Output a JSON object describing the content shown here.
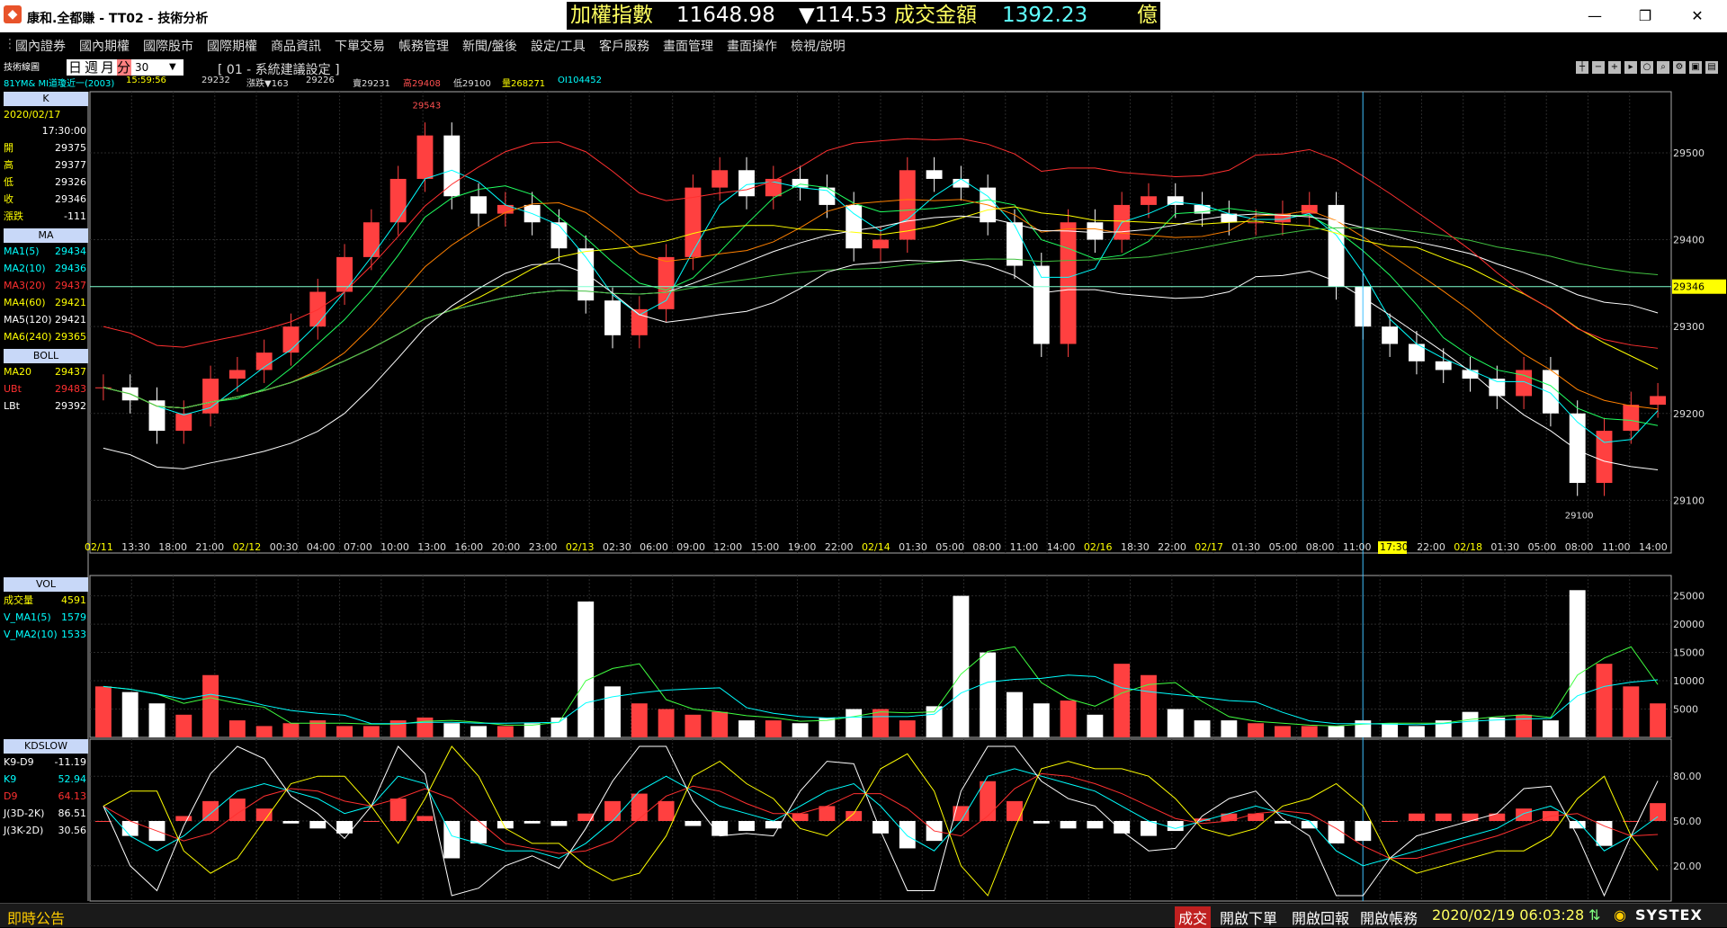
{
  "window": {
    "title": "康和.全都賺 - TT02 - 技術分析",
    "controls": {
      "minimize": "—",
      "maximize": "❐",
      "close": "✕"
    }
  },
  "ticker": {
    "label": "加權指數",
    "value": "11648.98",
    "change": "▼114.53",
    "turnover_label": "成交金額",
    "turnover": "1392.23",
    "unit": "億"
  },
  "menu": [
    "國內證券",
    "國內期權",
    "國際股市",
    "國際期權",
    "商品資訊",
    "下單交易",
    "帳務管理",
    "新聞/盤後",
    "設定/工具",
    "客戶服務",
    "畫面管理",
    "畫面操作",
    "檢視/說明"
  ],
  "toolbar": {
    "panel_title": "技術線圖",
    "symbol": "81YM&  MI道瓊近一(2003)",
    "period_tabs": [
      "日",
      "週",
      "月",
      "分"
    ],
    "active_period": "分",
    "interval": "30",
    "setting": "[ 01 - 系統建議設定 ]",
    "quote": {
      "time": "15:59:56",
      "bid": "29232",
      "change": "漲跌▼163",
      "ask": "29226",
      "sell_label": "賣29231",
      "high_label": "高29408",
      "low_label": "低29100",
      "vol_label": "量268271",
      "oi_label": "OI104452"
    }
  },
  "left_panel": {
    "k_label": "K",
    "date": "2020/02/17",
    "time": "17:30:00",
    "ohlc": [
      {
        "name": "開",
        "value": "29375"
      },
      {
        "name": "高",
        "value": "29377"
      },
      {
        "name": "低",
        "value": "29326"
      },
      {
        "name": "收",
        "value": "29346"
      },
      {
        "name": "漲跌",
        "value": "-111"
      }
    ],
    "ma_label": "MA",
    "ma": [
      {
        "name": "MA1(5)",
        "value": "29434",
        "color": "#00ffff"
      },
      {
        "name": "MA2(10)",
        "value": "29436",
        "color": "#00ffff"
      },
      {
        "name": "MA3(20)",
        "value": "29437",
        "color": "#ff3030"
      },
      {
        "name": "MA4(60)",
        "value": "29421",
        "color": "#ffff00"
      },
      {
        "name": "MA5(120)",
        "value": "29421",
        "color": "#ffffff"
      },
      {
        "name": "MA6(240)",
        "value": "29365",
        "color": "#ffff00"
      }
    ],
    "boll_label": "BOLL",
    "boll": [
      {
        "name": "MA20",
        "value": "29437",
        "color": "#ffff00"
      },
      {
        "name": "UBt",
        "value": "29483",
        "color": "#ff3030"
      },
      {
        "name": "LBt",
        "value": "29392",
        "color": "#ffffff"
      }
    ],
    "vol_label": "VOL",
    "vol": [
      {
        "name": "成交量",
        "value": "4591",
        "color": "#ffff00"
      },
      {
        "name": "V_MA1(5)",
        "value": "1579",
        "color": "#00ffff"
      },
      {
        "name": "V_MA2(10)",
        "value": "1533",
        "color": "#00ffff"
      }
    ],
    "kd_label": "KDSLOW",
    "kd": [
      {
        "name": "K9-D9",
        "value": "-11.19",
        "color": "#ffffff"
      },
      {
        "name": "K9",
        "value": "52.94",
        "color": "#00ffff"
      },
      {
        "name": "D9",
        "value": "64.13",
        "color": "#ff3030"
      },
      {
        "name": "J(3D-2K)",
        "value": "86.51",
        "color": "#ffffff"
      },
      {
        "name": "J(3K-2D)",
        "value": "30.56",
        "color": "#ffffff"
      }
    ]
  },
  "chart_data": {
    "type": "line",
    "price_axis": {
      "ticks": [
        29100,
        29200,
        29300,
        29400,
        29500
      ],
      "min": 29060,
      "max": 29560
    },
    "current_price": "29346",
    "high_marker": "29543",
    "low_marker": "29100",
    "time_axis": [
      "02/11",
      "13:30",
      "18:00",
      "21:00",
      "02/12",
      "00:30",
      "04:00",
      "07:00",
      "10:00",
      "13:00",
      "16:00",
      "20:00",
      "23:00",
      "02/13",
      "02:30",
      "06:00",
      "09:00",
      "12:00",
      "15:00",
      "19:00",
      "22:00",
      "02/14",
      "01:30",
      "05:00",
      "08:00",
      "11:00",
      "14:00",
      "02/16",
      "18:30",
      "22:00",
      "02/17",
      "01:30",
      "05:00",
      "08:00",
      "11:00",
      "17:30",
      "22:00",
      "02/18",
      "01:30",
      "05:00",
      "08:00",
      "11:00",
      "14:00"
    ],
    "date_labels": [
      "02/11",
      "02/12",
      "02/13",
      "02/14",
      "02/16",
      "02/17",
      "02/18"
    ],
    "cursor_time": "17:30",
    "volume_axis": {
      "ticks": [
        5000,
        10000,
        15000,
        20000,
        25000
      ],
      "max": 27000
    },
    "kd_axis": {
      "ticks": [
        20,
        50,
        80
      ],
      "min": 0,
      "max": 100
    },
    "close_series": [
      29230,
      29215,
      29180,
      29200,
      29240,
      29250,
      29270,
      29300,
      29340,
      29380,
      29420,
      29470,
      29520,
      29450,
      29430,
      29440,
      29420,
      29390,
      29330,
      29290,
      29320,
      29380,
      29460,
      29480,
      29450,
      29470,
      29460,
      29440,
      29390,
      29400,
      29480,
      29470,
      29460,
      29420,
      29370,
      29280,
      29420,
      29400,
      29440,
      29450,
      29440,
      29430,
      29420,
      29420,
      29430,
      29440,
      29346,
      29300,
      29280,
      29260,
      29250,
      29240,
      29220,
      29250,
      29200,
      29120,
      29180,
      29210,
      29220
    ],
    "volume_series": [
      9000,
      8000,
      6000,
      4000,
      11000,
      3000,
      2000,
      2500,
      3000,
      2000,
      2000,
      3000,
      3500,
      2500,
      2000,
      2000,
      2500,
      3500,
      24000,
      9000,
      6000,
      5000,
      4000,
      4500,
      3000,
      3000,
      2500,
      3500,
      5000,
      5000,
      3000,
      5500,
      25000,
      15000,
      8000,
      6000,
      6500,
      4000,
      13000,
      11000,
      5000,
      3000,
      3000,
      2500,
      2000,
      2000,
      2000,
      3000,
      2500,
      2000,
      3000,
      4500,
      3500,
      4000,
      3000,
      26000,
      13000,
      9000,
      6000
    ],
    "kd_k_series": [
      60,
      40,
      30,
      40,
      55,
      70,
      75,
      70,
      65,
      55,
      60,
      80,
      75,
      40,
      35,
      30,
      30,
      25,
      35,
      50,
      70,
      80,
      70,
      60,
      55,
      50,
      60,
      70,
      75,
      60,
      40,
      30,
      50,
      80,
      85,
      80,
      75,
      70,
      60,
      50,
      45,
      50,
      55,
      60,
      55,
      50,
      30,
      20,
      25,
      30,
      35,
      40,
      45,
      55,
      60,
      50,
      30,
      40,
      52.94
    ]
  },
  "status": {
    "left": "即時公告",
    "tab_trade": "成交",
    "tab_order": "開啟下單",
    "tab_report": "開啟回報",
    "tab_account": "開啟帳務",
    "datetime": "2020/02/19 06:03:28",
    "brand": "SYSTEX"
  },
  "colors": {
    "up": "#ff4040",
    "down": "#ffffff",
    "grid": "#333333",
    "label_bg": "#c8d8f8"
  }
}
